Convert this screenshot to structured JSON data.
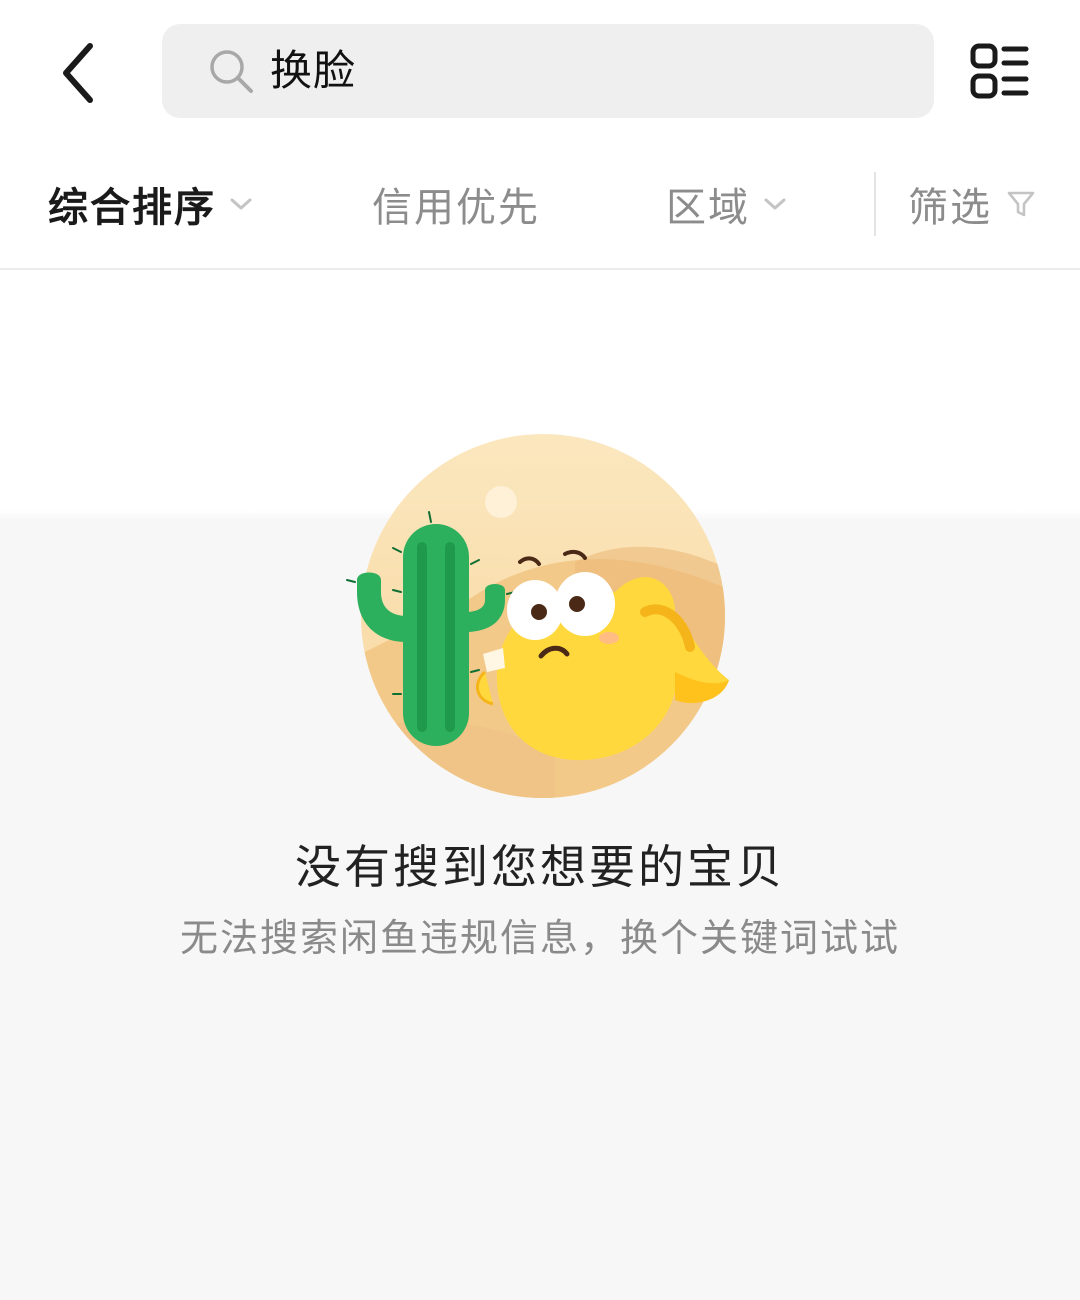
{
  "search": {
    "query": "换脸"
  },
  "sort_bar": {
    "items": [
      {
        "label": "综合排序",
        "active": true
      },
      {
        "label": "信用优先",
        "active": false
      },
      {
        "label": "区域",
        "active": false
      },
      {
        "label": "筛选",
        "active": false
      }
    ]
  },
  "empty_state": {
    "title": "没有搜到您想要的宝贝",
    "subtitle": "无法搜索闲鱼违规信息，换个关键词试试"
  },
  "icons": {
    "back": "chevron-left-icon",
    "search": "search-icon",
    "layout_toggle": "list-layout-icon",
    "dropdown": "chevron-down-icon",
    "filter": "funnel-icon"
  },
  "colors": {
    "active_text": "#1a1a1a",
    "inactive_text": "#8c8c8c",
    "search_bg": "#efefef",
    "empty_bg": "#f7f7f7"
  }
}
